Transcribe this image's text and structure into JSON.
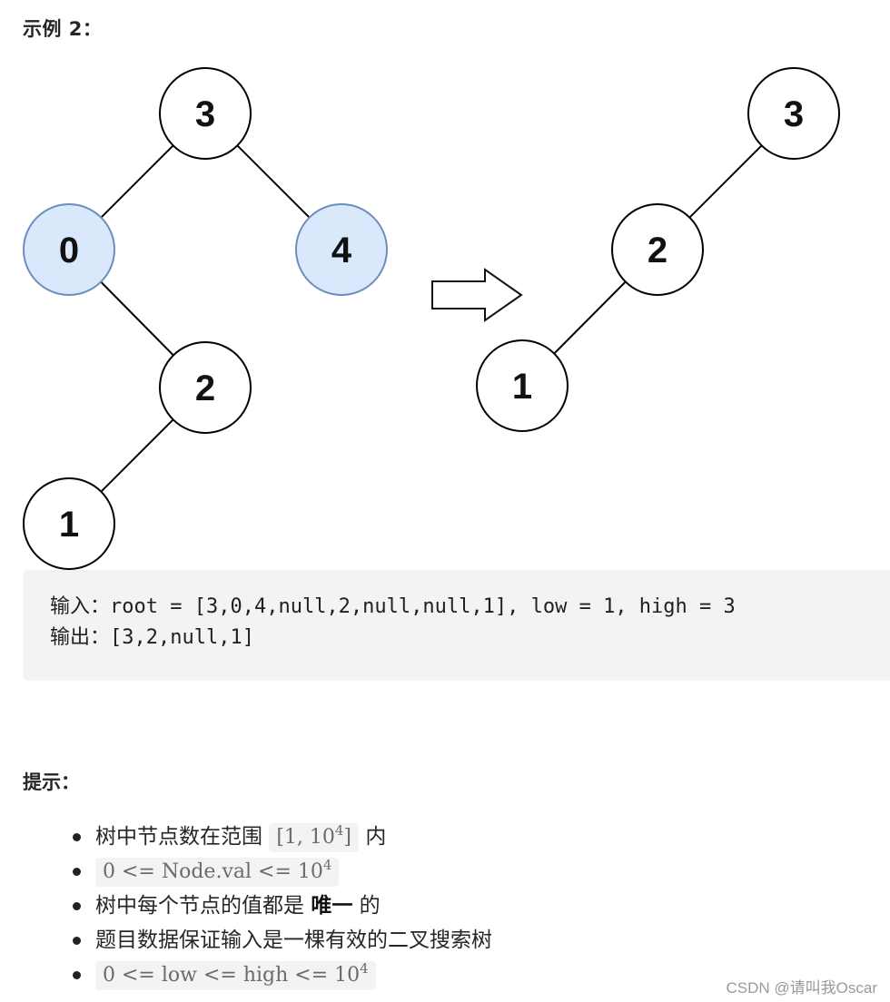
{
  "example": {
    "title": "示例 2："
  },
  "diagram": {
    "colors": {
      "highlight_fill": "#dae8fc",
      "highlight_stroke": "#6c8ebf",
      "node_fill": "#ffffff",
      "node_stroke": "#000000"
    },
    "input_tree": {
      "nodes": [
        {
          "id": "in-3",
          "value": "3",
          "highlighted": false
        },
        {
          "id": "in-0",
          "value": "0",
          "highlighted": true
        },
        {
          "id": "in-4",
          "value": "4",
          "highlighted": true
        },
        {
          "id": "in-2",
          "value": "2",
          "highlighted": false
        },
        {
          "id": "in-1",
          "value": "1",
          "highlighted": false
        }
      ],
      "edges": [
        [
          "in-3",
          "in-0"
        ],
        [
          "in-3",
          "in-4"
        ],
        [
          "in-0",
          "in-2"
        ],
        [
          "in-2",
          "in-1"
        ]
      ]
    },
    "output_tree": {
      "nodes": [
        {
          "id": "out-3",
          "value": "3",
          "highlighted": false
        },
        {
          "id": "out-2",
          "value": "2",
          "highlighted": false
        },
        {
          "id": "out-1",
          "value": "1",
          "highlighted": false
        }
      ],
      "edges": [
        [
          "out-3",
          "out-2"
        ],
        [
          "out-2",
          "out-1"
        ]
      ]
    },
    "arrow": "right-arrow-icon"
  },
  "code": {
    "input_prefix": "输入：",
    "input_value": "root = [3,0,4,null,2,null,null,1], low = 1, high = 3",
    "output_prefix": "输出：",
    "output_value": "[3,2,null,1]"
  },
  "hints": {
    "title": "提示：",
    "items": [
      {
        "text_before": "树中节点数在范围 ",
        "code": "[1, 10",
        "code_sup": "4",
        "code_after": "]",
        "text_after": " 内"
      },
      {
        "code": "0 <= Node.val <= 10",
        "code_sup": "4"
      },
      {
        "text_before": "树中每个节点的值都是 ",
        "bold": "唯一",
        "text_after": " 的"
      },
      {
        "text_before": "题目数据保证输入是一棵有效的二叉搜索树"
      },
      {
        "code": "0 <= low <= high <= 10",
        "code_sup": "4"
      }
    ]
  },
  "watermark": "CSDN @请叫我Oscar"
}
